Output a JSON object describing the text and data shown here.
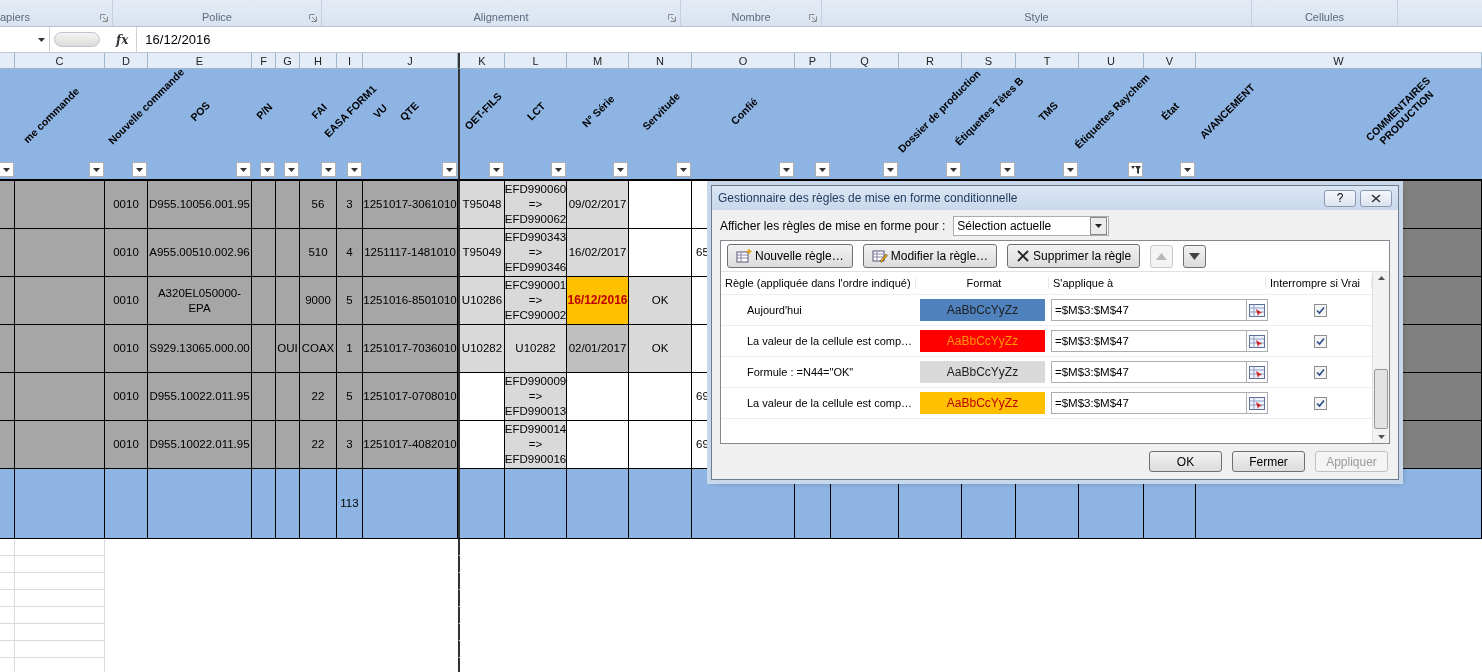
{
  "ribbon_groups": [
    {
      "label": "apiers",
      "launcher": true
    },
    {
      "label": "Police",
      "launcher": true
    },
    {
      "label": "Alignement",
      "launcher": true
    },
    {
      "label": "Nombre",
      "launcher": true
    },
    {
      "label": "Style",
      "launcher": false
    },
    {
      "label": "Cellules",
      "launcher": false
    }
  ],
  "formula_bar": {
    "function_label": "fx",
    "value": "16/12/2016"
  },
  "columns": [
    {
      "filtered": false
    },
    {
      "letter": "C",
      "headers": [
        "me commande"
      ],
      "filtered": false
    },
    {
      "letter": "D",
      "headers": [
        "Nouvelle commande"
      ],
      "filtered": false
    },
    {
      "letter": "E",
      "headers": [
        "POS"
      ],
      "filtered": false
    },
    {
      "letter": "F",
      "headers": [
        "P/N"
      ],
      "filtered": false
    },
    {
      "letter": "G",
      "filtered": false
    },
    {
      "letter": "H",
      "headers": [
        "FAI"
      ],
      "filtered": false
    },
    {
      "letter": "I",
      "headers": [
        "EASA FORM1"
      ],
      "filtered": false
    },
    {
      "letter": "J",
      "headers": [
        "VU",
        "QTE"
      ],
      "filtered": false
    },
    {
      "letter": "K",
      "headers": [
        "OET-FILS"
      ],
      "filtered": false
    },
    {
      "letter": "L",
      "headers": [
        "LCT"
      ],
      "filtered": false
    },
    {
      "letter": "M",
      "headers": [
        "N° Série"
      ],
      "filtered": false
    },
    {
      "letter": "N",
      "headers": [
        "Servitude"
      ],
      "filtered": false
    },
    {
      "letter": "O",
      "headers": [
        "Confié"
      ],
      "filtered": false
    },
    {
      "letter": "P",
      "filtered": false
    },
    {
      "letter": "Q",
      "filtered": false
    },
    {
      "letter": "R",
      "headers": [
        "Dossier de production"
      ],
      "filtered": false
    },
    {
      "letter": "S",
      "headers": [
        "Étiquettes Têtes B"
      ],
      "filtered": false
    },
    {
      "letter": "T",
      "headers": [
        "TMS"
      ],
      "filtered": false
    },
    {
      "letter": "U",
      "headers": [
        "Étiquettes Raychem"
      ],
      "filtered": true
    },
    {
      "letter": "V",
      "headers": [
        "État"
      ],
      "filtered": false
    },
    {
      "letter": "W",
      "headers": [
        "AVANCEMENT",
        "COMMENTAIRES PRODUCTION"
      ]
    }
  ],
  "rows": [
    {
      "kind": "data",
      "cells": [
        null,
        null,
        "0010",
        "D955.10056.001.95",
        null,
        null,
        "56",
        "3",
        "1251017-3061010",
        "T95048",
        "EFD990060\n=>\nEFD990062",
        "09/02/2017",
        null,
        null,
        null,
        null,
        null,
        null,
        null,
        null,
        null,
        null
      ]
    },
    {
      "kind": "data",
      "cells": [
        null,
        null,
        "0010",
        "A955.00510.002.96",
        null,
        null,
        "510",
        "4",
        "1251117-1481010",
        "T95049",
        "EFD990343\n=>\nEFD990346",
        "16/02/2017",
        null,
        "65",
        null,
        null,
        null,
        null,
        null,
        null,
        null,
        null
      ]
    },
    {
      "kind": "data",
      "cells": [
        null,
        null,
        "0010",
        "A320EL050000-EPA",
        null,
        null,
        "9000",
        "5",
        "1251016-8501010",
        "U10286",
        "EFC990001\n=>\nEFC990002",
        {
          "color": "#ffc000",
          "label": {
            "text": "16/12/2016",
            "color": "#c00000"
          }
        },
        "OK",
        null,
        null,
        null,
        null,
        null,
        null,
        null,
        null,
        null
      ]
    },
    {
      "kind": "data",
      "cells": [
        null,
        null,
        "0010",
        "S929.13065.000.00",
        null,
        "OUI",
        "COAX",
        "1",
        "1251017-7036010",
        "U10282",
        "U10282",
        {
          "text": "02/01/2017",
          "color": "#bfbfbf"
        },
        "OK",
        null,
        null,
        null,
        null,
        null,
        null,
        null,
        null,
        null
      ]
    },
    {
      "kind": "data",
      "cells": [
        null,
        null,
        "0010",
        "D955.10022.011.95",
        null,
        null,
        "22",
        "5",
        "1251017-0708010",
        null,
        "EFD990009\n=>\nEFD990013",
        null,
        null,
        "69",
        null,
        null,
        null,
        null,
        null,
        null,
        null,
        null
      ]
    },
    {
      "kind": "data",
      "cells": [
        null,
        null,
        "0010",
        "D955.10022.011.95",
        null,
        null,
        "22",
        "3",
        "1251017-4082010",
        null,
        "EFD990014\n=>\nEFD990016",
        null,
        null,
        "69",
        null,
        null,
        null,
        null,
        null,
        null,
        null,
        null
      ]
    },
    {
      "kind": "total",
      "cells": [
        null,
        null,
        null,
        null,
        null,
        null,
        null,
        "113",
        null,
        null,
        null,
        null,
        null,
        null,
        null,
        null,
        null,
        null,
        null,
        null,
        null,
        null
      ]
    }
  ],
  "dialog": {
    "title": "Gestionnaire des règles de mise en forme conditionnelle",
    "help": "?",
    "show_rules_label": "Afficher les règles de mise en forme pour :",
    "scope": "Sélection actuelle",
    "toolbar": [
      {
        "kind": "new",
        "label": "Nouvelle règle…"
      },
      {
        "kind": "edit",
        "label": "Modifier la règle…"
      },
      {
        "kind": "delete",
        "label": "Supprimer la règle"
      }
    ],
    "move_buttons": [
      {
        "kind": "up",
        "disabled": true
      },
      {
        "kind": "down",
        "disabled": false
      }
    ],
    "columns": [
      "Règle (appliquée dans l'ordre indiqué)",
      "Format",
      "S'applique à",
      "Interrompre si Vrai"
    ],
    "rules": [
      {
        "rule": "Aujourd'hui",
        "preview": {
          "text": "AaBbCcYyZz",
          "color": "#1f1f1f"
        },
        "color": "#4f81bd",
        "applies_to": "=$M$3:$M$47",
        "stop_if_true": true
      },
      {
        "rule": "La valeur de la cellule est comp…",
        "preview": {
          "text": "AaBbCcYyZz",
          "color": "#ff9900"
        },
        "color": "#ff0000",
        "applies_to": "=$M$3:$M$47",
        "stop_if_true": true
      },
      {
        "rule": "Formule : =N44=\"OK\"",
        "preview": {
          "text": "AaBbCcYyZz",
          "color": "#1f1f1f"
        },
        "color": "#d9d9d9",
        "applies_to": "=$M$3:$M$47",
        "stop_if_true": true
      },
      {
        "rule": "La valeur de la cellule est comp…",
        "preview": {
          "text": "AaBbCcYyZz",
          "color": "#c00000"
        },
        "color": "#ffc000",
        "applies_to": "=$M$3:$M$47",
        "stop_if_true": true
      }
    ],
    "buttons": [
      {
        "label": "OK",
        "disabled": false
      },
      {
        "label": "Fermer",
        "disabled": false
      },
      {
        "label": "Appliquer",
        "disabled": true
      }
    ]
  }
}
